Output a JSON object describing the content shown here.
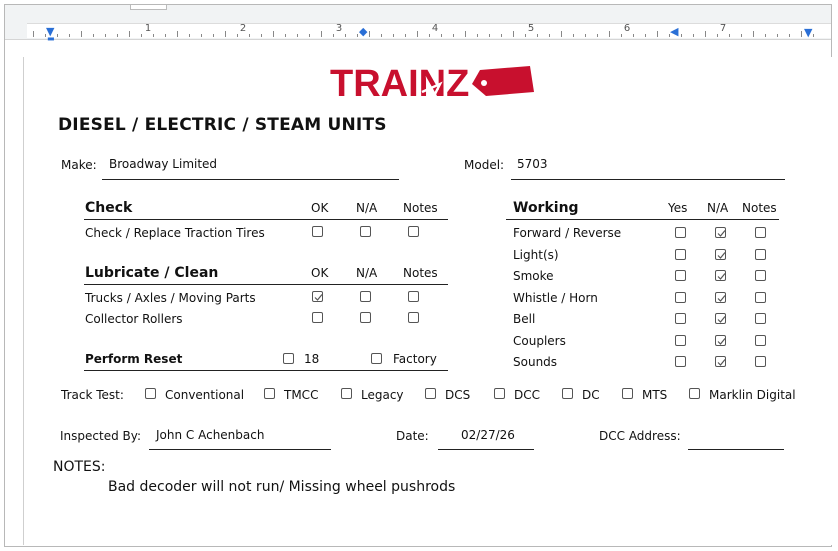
{
  "ruler": {
    "numbers": [
      "1",
      "2",
      "3",
      "4",
      "5",
      "6",
      "7"
    ]
  },
  "logo": {
    "text": "TRAINZ",
    "brand_color": "#c8102e"
  },
  "form": {
    "title": "DIESEL / ELECTRIC / STEAM UNITS",
    "make_label": "Make:",
    "make_value": "Broadway Limited",
    "model_label": "Model:",
    "model_value": "5703",
    "check": {
      "heading": "Check",
      "cols": [
        "OK",
        "N/A",
        "Notes"
      ],
      "rows": [
        {
          "label": "Check / Replace Traction Tires",
          "checked": [
            false,
            false,
            false
          ]
        }
      ]
    },
    "lubricate": {
      "heading": "Lubricate / Clean",
      "cols": [
        "OK",
        "N/A",
        "Notes"
      ],
      "rows": [
        {
          "label": "Trucks / Axles / Moving Parts",
          "checked": [
            true,
            false,
            false
          ]
        },
        {
          "label": "Collector Rollers",
          "checked": [
            false,
            false,
            false
          ]
        }
      ]
    },
    "reset": {
      "label": "Perform Reset",
      "options": [
        {
          "label": "18",
          "checked": false
        },
        {
          "label": "Factory",
          "checked": false
        }
      ]
    },
    "working": {
      "heading": "Working",
      "cols": [
        "Yes",
        "N/A",
        "Notes"
      ],
      "rows": [
        {
          "label": "Forward / Reverse",
          "checked": [
            false,
            true,
            false
          ]
        },
        {
          "label": "Light(s)",
          "checked": [
            false,
            true,
            false
          ]
        },
        {
          "label": "Smoke",
          "checked": [
            false,
            true,
            false
          ]
        },
        {
          "label": "Whistle / Horn",
          "checked": [
            false,
            true,
            false
          ]
        },
        {
          "label": "Bell",
          "checked": [
            false,
            true,
            false
          ]
        },
        {
          "label": "Couplers",
          "checked": [
            false,
            true,
            false
          ]
        },
        {
          "label": "Sounds",
          "checked": [
            false,
            true,
            false
          ]
        }
      ]
    },
    "track_test": {
      "label": "Track Test:",
      "options": [
        {
          "label": "Conventional",
          "checked": false
        },
        {
          "label": "TMCC",
          "checked": false
        },
        {
          "label": "Legacy",
          "checked": false
        },
        {
          "label": "DCS",
          "checked": false
        },
        {
          "label": "DCC",
          "checked": false
        },
        {
          "label": "DC",
          "checked": false
        },
        {
          "label": "MTS",
          "checked": false
        },
        {
          "label": "Marklin Digital",
          "checked": false
        }
      ]
    },
    "inspected_label": "Inspected By:",
    "inspected_value": "John C Achenbach",
    "date_label": "Date:",
    "date_value": "02/27/26",
    "dcc_label": "DCC Address:",
    "dcc_value": "",
    "notes_label": "NOTES:",
    "notes_value": "Bad decoder will not run/ Missing wheel pushrods"
  }
}
